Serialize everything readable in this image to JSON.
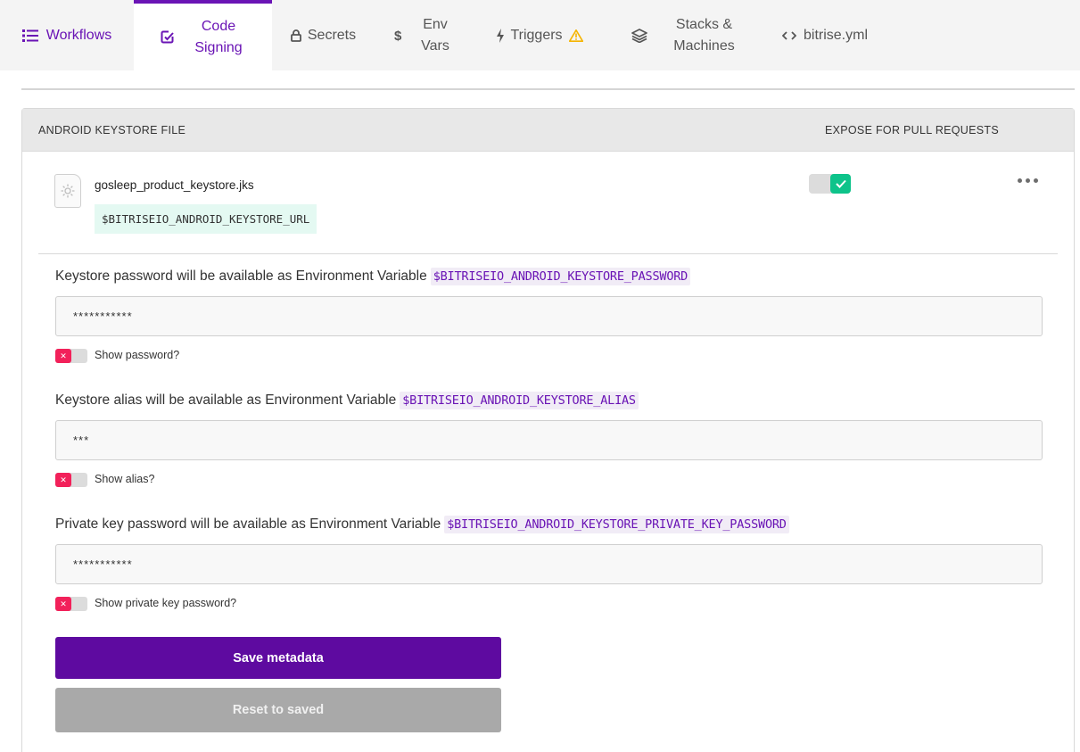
{
  "nav": {
    "tabs": [
      {
        "label": "Workflows",
        "icon": "list-icon"
      },
      {
        "label": "Code Signing",
        "icon": "edit-check-icon",
        "active": true
      },
      {
        "label": "Secrets",
        "icon": "lock-icon"
      },
      {
        "label": "Env Vars",
        "icon": "dollar-icon"
      },
      {
        "label": "Triggers",
        "icon": "bolt-icon",
        "warning": true
      },
      {
        "label": "Stacks & Machines",
        "icon": "layers-icon"
      },
      {
        "label": "bitrise.yml",
        "icon": "code-icon"
      }
    ]
  },
  "card": {
    "header_left": "ANDROID KEYSTORE FILE",
    "header_right": "EXPOSE FOR PULL REQUESTS",
    "file_name": "gosleep_product_keystore.jks",
    "file_env_var": "$BITRISEIO_ANDROID_KEYSTORE_URL",
    "expose_enabled": true
  },
  "fields": {
    "password": {
      "label": "Keystore password will be available as Environment Variable",
      "env": "$BITRISEIO_ANDROID_KEYSTORE_PASSWORD",
      "value": "***********",
      "toggle_label": "Show password?"
    },
    "alias": {
      "label": "Keystore alias will be available as Environment Variable",
      "env": "$BITRISEIO_ANDROID_KEYSTORE_ALIAS",
      "value": "***",
      "toggle_label": "Show alias?"
    },
    "private_key": {
      "label": "Private key password will be available as Environment Variable",
      "env": "$BITRISEIO_ANDROID_KEYSTORE_PRIVATE_KEY_PASSWORD",
      "value": "***********",
      "toggle_label": "Show private key password?"
    }
  },
  "buttons": {
    "save": "Save metadata",
    "reset": "Reset to saved"
  },
  "colors": {
    "accent": "#6a14b5",
    "save_button": "#5e0aa0",
    "toggle_on": "#0dc38a",
    "toggle_off": "#f2215a",
    "env_chip_bg": "#f1ecf6",
    "file_var_bg": "#e4f9f2"
  }
}
